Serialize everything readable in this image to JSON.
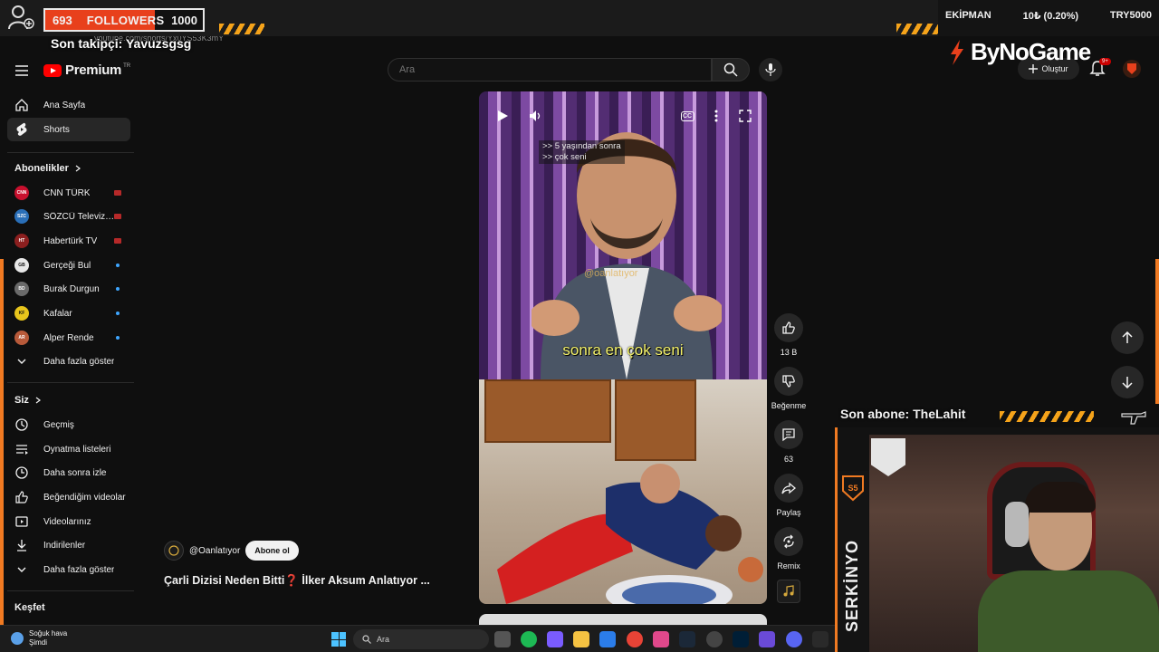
{
  "overlay": {
    "followers_current": "693",
    "followers_label": "FOLLOWERS",
    "followers_goal": "1000",
    "followers_progress": 0.693,
    "last_follower": "Son takipçi: Yavuzsgsg",
    "url": "youtube.com/shorts/Yx0YS53K3mY",
    "brand": "ByNoGame",
    "ticker": {
      "label": "EKİPMAN",
      "value": "10₺ (0.20%)",
      "goal": "TRY5000"
    },
    "last_subscriber": "Son abone: TheLahit",
    "streamer_name": "SERKİNYO",
    "accent_color": "#f07a22"
  },
  "header": {
    "logo_text": "Premium",
    "logo_sup": "TR",
    "search_placeholder": "Ara",
    "create_label": "Oluştur",
    "notif_badge": "9+"
  },
  "sidebar": {
    "main": [
      {
        "label": "Ana Sayfa",
        "icon": "home-icon"
      },
      {
        "label": "Shorts",
        "icon": "shorts-icon",
        "active": true
      }
    ],
    "subs_title": "Abonelikler",
    "subs": [
      {
        "label": "CNN TÜRK",
        "avatar_text": "CNN",
        "color": "#c8102e",
        "status": "live"
      },
      {
        "label": "SÖZCÜ Televizyo...",
        "avatar_text": "SZC",
        "color": "#2a6fb8",
        "status": "live"
      },
      {
        "label": "Habertürk TV",
        "avatar_text": "HT",
        "color": "#8c1f1f",
        "status": "live"
      },
      {
        "label": "Gerçeği Bul",
        "avatar_text": "GB",
        "color": "#e8e8e8",
        "status": "new"
      },
      {
        "label": "Burak Durgun",
        "avatar_text": "BD",
        "color": "#6a6a6a",
        "status": "new"
      },
      {
        "label": "Kafalar",
        "avatar_text": "KF",
        "color": "#e8c51c",
        "status": "new"
      },
      {
        "label": "Alper Rende",
        "avatar_text": "AR",
        "color": "#b85a3a",
        "status": "new"
      }
    ],
    "show_more": "Daha fazla göster",
    "you_title": "Siz",
    "you": [
      {
        "label": "Geçmiş",
        "icon": "history-icon"
      },
      {
        "label": "Oynatma listeleri",
        "icon": "playlist-icon"
      },
      {
        "label": "Daha sonra izle",
        "icon": "watch-later-icon"
      },
      {
        "label": "Beğendiğim videolar",
        "icon": "liked-icon"
      },
      {
        "label": "Videolarınız",
        "icon": "your-videos-icon"
      },
      {
        "label": "İndirilenler",
        "icon": "download-icon"
      }
    ],
    "show_more_2": "Daha fazla göster",
    "explore_title": "Keşfet"
  },
  "short": {
    "subtitle_line1": ">> 5 yaşından sonra",
    "subtitle_line2": ">> çok seni",
    "watermark": "@oanlatıyor",
    "caption": "sonra en çok seni",
    "cc_label": "CC",
    "channel": "@Oanlatıyor",
    "subscribe_label": "Abone ol",
    "title": "Çarli Dizisi Neden Bitti❓ İlker Aksum Anlatıyor ..."
  },
  "actions": {
    "likes": "13 B",
    "dislike_label": "Beğenme",
    "comments": "63",
    "share_label": "Paylaş",
    "remix_label": "Remix"
  },
  "taskbar": {
    "weather_line1": "Soğuk hava",
    "weather_line2": "Şimdi",
    "search_label": "Ara"
  }
}
